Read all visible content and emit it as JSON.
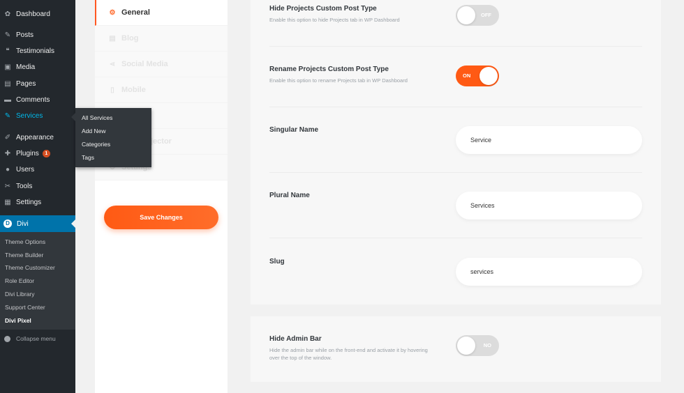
{
  "wp_menu": {
    "items": [
      {
        "label": "Dashboard",
        "icon": "dashboard-icon",
        "glyph": "✿"
      },
      {
        "label": "Posts",
        "icon": "pin-icon",
        "glyph": "✎"
      },
      {
        "label": "Testimonials",
        "icon": "quote-icon",
        "glyph": "❝"
      },
      {
        "label": "Media",
        "icon": "media-icon",
        "glyph": "▣"
      },
      {
        "label": "Pages",
        "icon": "pages-icon",
        "glyph": "▤"
      },
      {
        "label": "Comments",
        "icon": "comment-icon",
        "glyph": "▬"
      },
      {
        "label": "Services",
        "icon": "pin-icon",
        "glyph": "✎"
      },
      {
        "label": "Appearance",
        "icon": "brush-icon",
        "glyph": "✐"
      },
      {
        "label": "Plugins",
        "icon": "plugin-icon",
        "glyph": "✚",
        "badge": "1"
      },
      {
        "label": "Users",
        "icon": "user-icon",
        "glyph": "●"
      },
      {
        "label": "Tools",
        "icon": "wrench-icon",
        "glyph": "✂"
      },
      {
        "label": "Settings",
        "icon": "settings-icon",
        "glyph": "▦"
      }
    ],
    "divi": {
      "label": "Divi",
      "icon_letter": "D"
    },
    "divi_sub": [
      {
        "label": "Theme Options"
      },
      {
        "label": "Theme Builder"
      },
      {
        "label": "Theme Customizer"
      },
      {
        "label": "Role Editor"
      },
      {
        "label": "Divi Library"
      },
      {
        "label": "Support Center"
      },
      {
        "label": "Divi Pixel"
      }
    ],
    "collapse_label": "Collapse menu"
  },
  "services_flyout": [
    "All Services",
    "Add New",
    "Categories",
    "Tags"
  ],
  "settings_nav": {
    "tabs": [
      {
        "label": "General",
        "glyph": "⚙",
        "active": true
      },
      {
        "label": "Blog",
        "glyph": "▤"
      },
      {
        "label": "Social Media",
        "glyph": "⋖"
      },
      {
        "label": "Mobile",
        "glyph": "▯"
      },
      {
        "label": "",
        "glyph": ""
      },
      {
        "label": "jector",
        "glyph": ""
      },
      {
        "label": "Settings",
        "glyph": "⚙"
      }
    ],
    "save_label": "Save Changes"
  },
  "options": {
    "hide_projects": {
      "title": "Hide Projects Custom Post Type",
      "desc": "Enable this option to hide Projects tab in WP Dashboard",
      "state": "OFF"
    },
    "rename_projects": {
      "title": "Rename Projects Custom Post Type",
      "desc": "Enable this option to rename Projects tab in WP Dashboard",
      "state": "ON"
    },
    "singular_name": {
      "title": "Singular Name",
      "value": "Service"
    },
    "plural_name": {
      "title": "Plural Name",
      "value": "Services"
    },
    "slug": {
      "title": "Slug",
      "value": "services"
    },
    "hide_admin_bar": {
      "title": "Hide Admin Bar",
      "desc": "Hide the admin bar while on the front-end and activate it by hovering over the top of the window.",
      "state": "NO"
    }
  },
  "colors": {
    "accent": "#ff5a14",
    "wp_sidebar": "#23282d",
    "wp_active": "#0073aa"
  }
}
